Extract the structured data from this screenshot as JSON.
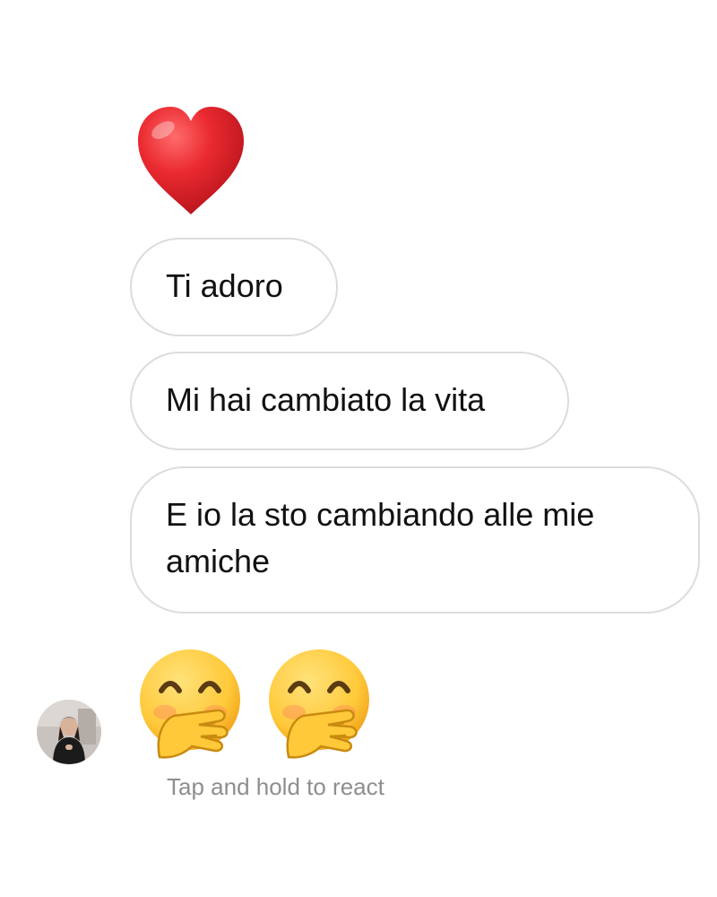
{
  "conversation": {
    "reaction_emoji": "red-heart-icon",
    "messages": [
      {
        "text": "Ti adoro"
      },
      {
        "text": "Mi hai cambiato la vita"
      },
      {
        "text": "E io la sto cambiando alle mie amiche"
      }
    ],
    "emoji_message": [
      "face-with-hand-over-mouth-icon",
      "face-with-hand-over-mouth-icon"
    ],
    "hint": "Tap and hold to react"
  },
  "colors": {
    "bubble_border": "#dcdcdc",
    "hint_text": "#8e8e8e",
    "heart": "#e0242c",
    "emoji_face": "#ffcb3a"
  }
}
